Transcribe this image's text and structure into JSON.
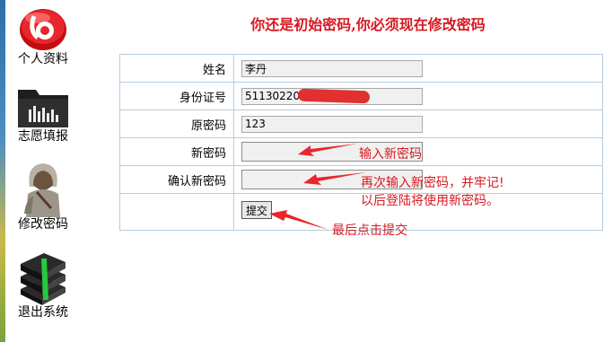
{
  "heading": "你还是初始密码,你必须现在修改密码",
  "sidebar": {
    "items": [
      {
        "label": "个人资料",
        "icon": "sohu-logo-icon"
      },
      {
        "label": "志愿填报",
        "icon": "folder-icon"
      },
      {
        "label": "修改密码",
        "icon": "user-avatar-icon"
      },
      {
        "label": "退出系统",
        "icon": "books-icon"
      }
    ]
  },
  "form": {
    "name_label": "姓名",
    "name_value": "李丹",
    "id_label": "身份证号",
    "id_value": "5113022000",
    "oldpw_label": "原密码",
    "oldpw_value": "123",
    "newpw_label": "新密码",
    "newpw_value": "",
    "confirm_label": "确认新密码",
    "confirm_value": "",
    "submit_label": "提交"
  },
  "annotations": {
    "a1": "输入新密码",
    "a2": "再次输入新密码，并牢记!",
    "a3": "以后登陆将使用新密码。",
    "a4": "最后点击提交"
  },
  "colors": {
    "accent_red": "#d71921",
    "border_blue": "#b7cde0"
  }
}
